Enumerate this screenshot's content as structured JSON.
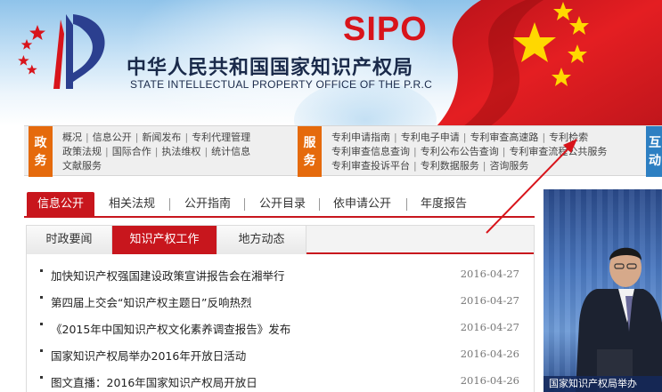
{
  "banner": {
    "cn_title": "中华人民共和国国家知识产权局",
    "en_title": "STATE INTELLECTUAL PROPERTY OFFICE OF THE P.R.C",
    "sipo": "SIPO"
  },
  "colors": {
    "brand_red": "#c8161d",
    "accent_orange": "#e56a0c",
    "sipo_red": "#d8141b"
  },
  "gov_services": {
    "tag_top": "政",
    "tag_bottom": "务",
    "lines": [
      [
        "概况",
        "信息公开",
        "新闻发布",
        "专利代理管理"
      ],
      [
        "政策法规",
        "国际合作",
        "执法维权",
        "统计信息"
      ],
      [
        "文献服务"
      ]
    ]
  },
  "public_services": {
    "tag_top": "服",
    "tag_bottom": "务",
    "lines": [
      [
        "专利申请指南",
        "专利电子申请",
        "专利审查高速路",
        "专利检索"
      ],
      [
        "专利审查信息查询",
        "专利公布公告查询",
        "专利审查流程公共服务"
      ],
      [
        "专利审查投诉平台",
        "专利数据服务",
        "咨询服务"
      ]
    ]
  },
  "third_tag": {
    "top": "互",
    "bottom": "动"
  },
  "info_tabs": {
    "active": "信息公开",
    "items": [
      "相关法规",
      "公开指南",
      "公开目录",
      "依申请公开",
      "年度报告"
    ]
  },
  "news_tabs": [
    "时政要闻",
    "知识产权工作",
    "地方动态"
  ],
  "news": [
    {
      "title": "加快知识产权强国建设政策宣讲报告会在湘举行",
      "date": "2016-04-27"
    },
    {
      "title": "第四届上交会“知识产权主题日”反响热烈",
      "date": "2016-04-27"
    },
    {
      "title": "《2015年中国知识产权文化素养调查报告》发布",
      "date": "2016-04-27"
    },
    {
      "title": "国家知识产权局举办2016年开放日活动",
      "date": "2016-04-26"
    },
    {
      "title": "图文直播：2016年国家知识产权局开放日",
      "date": "2016-04-26"
    }
  ],
  "photo": {
    "caption": "国家知识产权局举办"
  }
}
